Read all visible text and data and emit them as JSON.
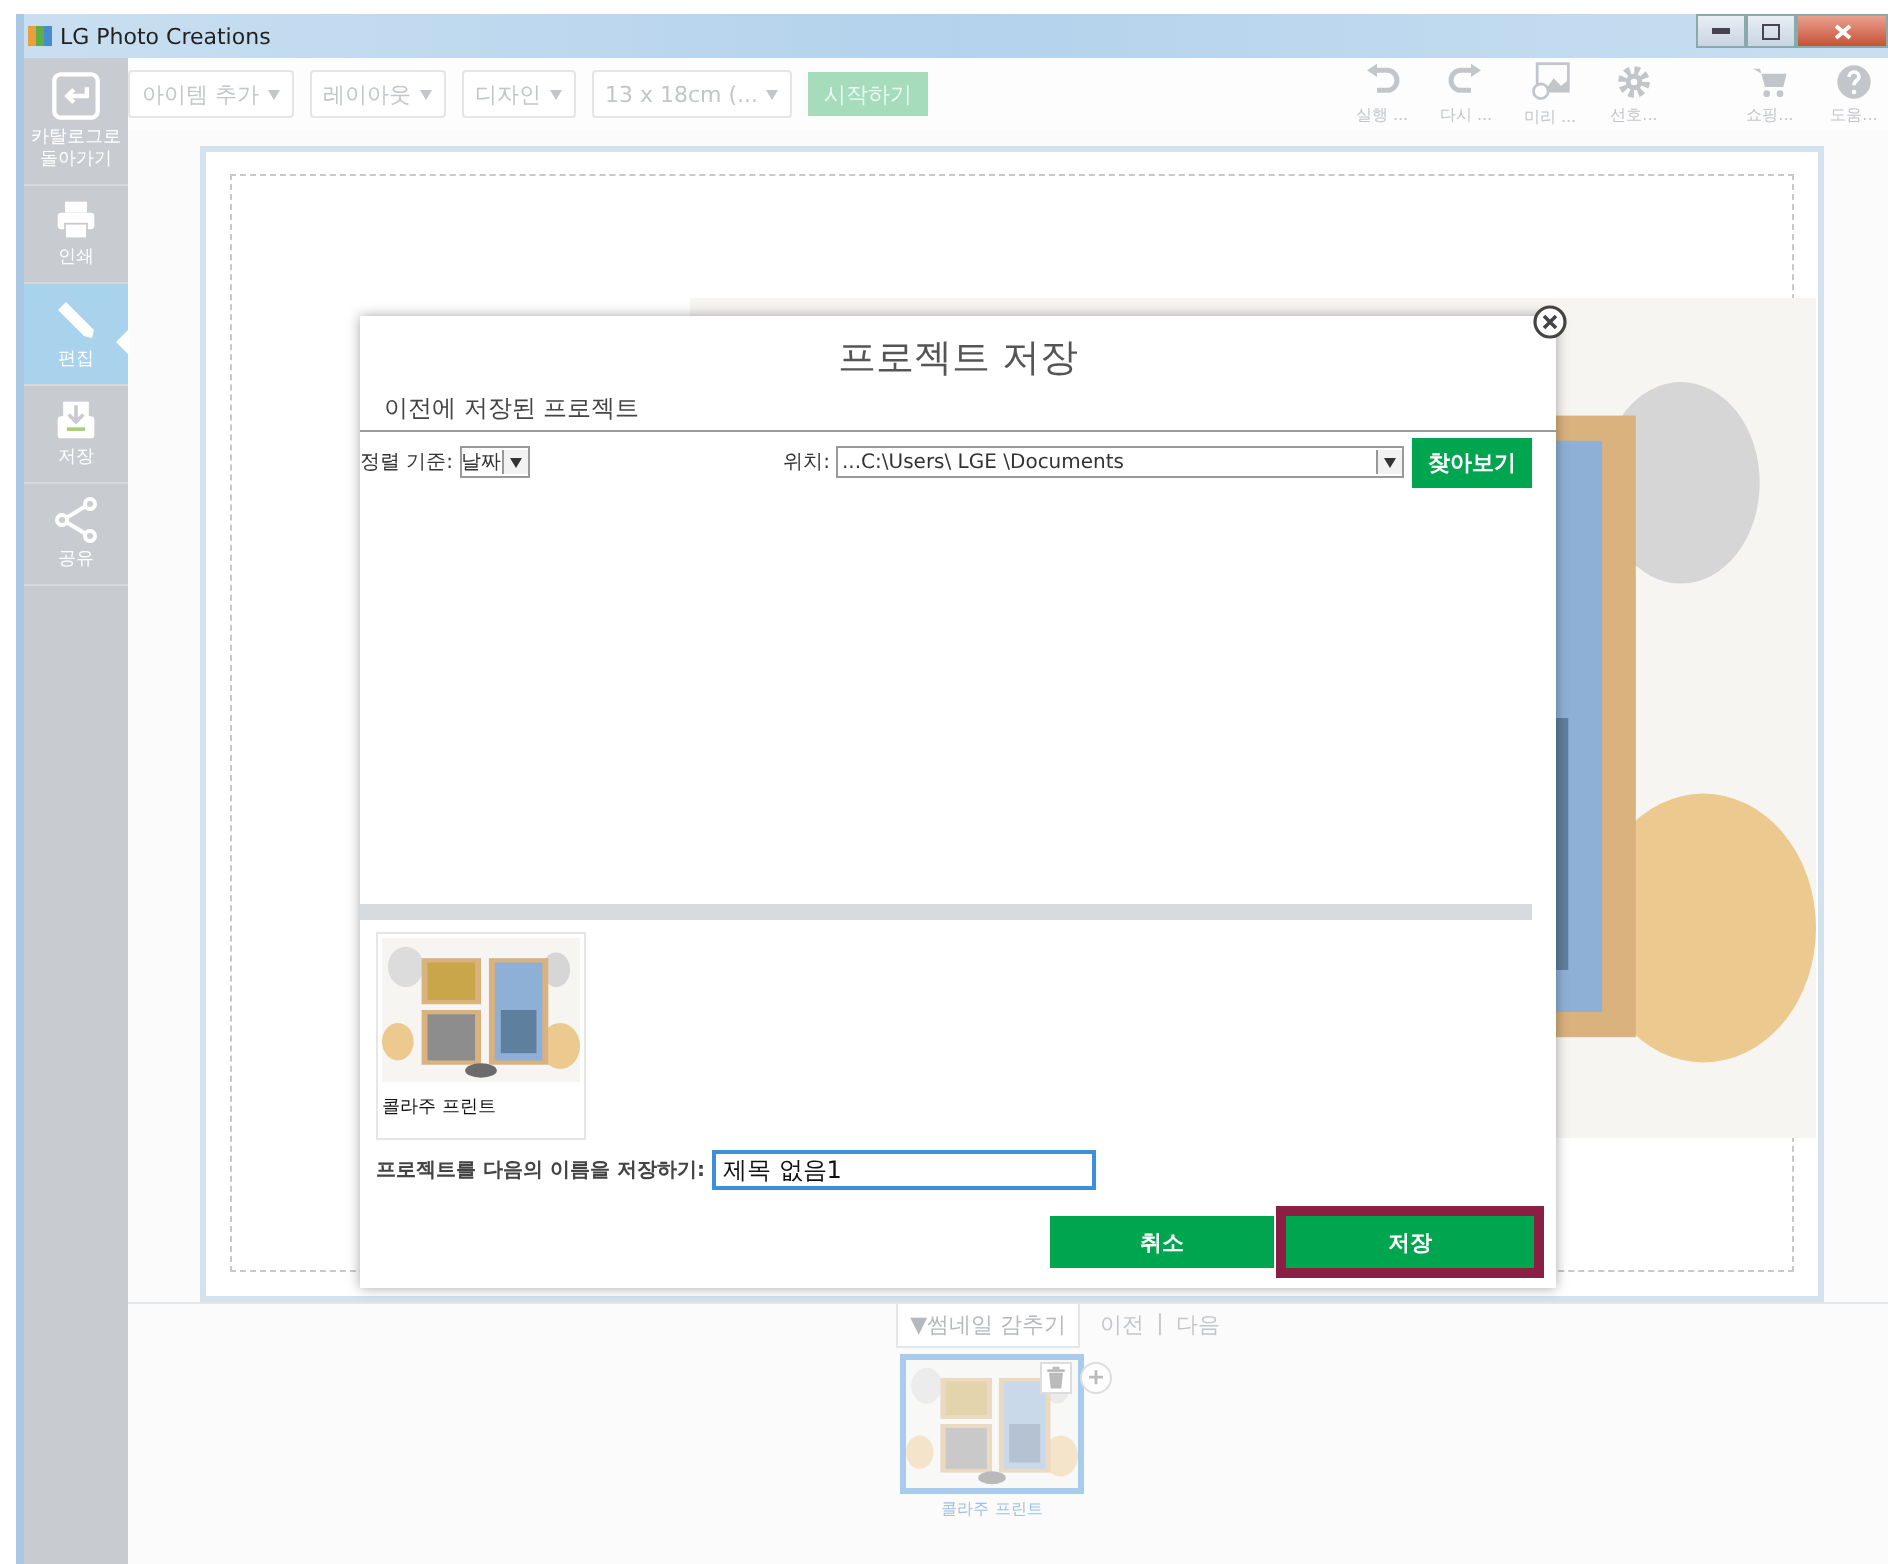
{
  "window": {
    "title": "LG Photo Creations"
  },
  "sidebar": {
    "items": [
      {
        "label": "카탈로그로 돌아가기",
        "selected": false
      },
      {
        "label": "인쇄",
        "selected": false
      },
      {
        "label": "편집",
        "selected": true
      },
      {
        "label": "저장",
        "selected": false
      },
      {
        "label": "공유",
        "selected": false
      }
    ]
  },
  "toolbar": {
    "disabled": true,
    "menus": [
      "아이템 추가",
      "레이아웃",
      "디자인",
      "13 x 18cm (..."
    ],
    "start_button": "시작하기",
    "actions": [
      "실행 ...",
      "다시 ...",
      "미리 ...",
      "선호...",
      "쇼핑...",
      "도움..."
    ]
  },
  "dialog": {
    "title": "프로젝트 저장",
    "section": "이전에 저장된 프로젝트",
    "sort_label": "정렬 기준:",
    "sort_value": "날짜",
    "location_label": "위치:",
    "location_value": "...C:\\Users\\ LGE \\Documents",
    "browse_button": "찾아보기",
    "projects": [
      {
        "name": "콜라주 프린트"
      }
    ],
    "name_label": "프로젝트를 다음의 이름을 저장하기:",
    "name_value": "제목 없음1",
    "buttons": [
      {
        "label": "취소",
        "highlighted": false
      },
      {
        "label": "저장",
        "highlighted": true
      }
    ]
  },
  "thumbnail_bar": {
    "toggle": "▼썸네일 감추기",
    "prev": "이전",
    "separator": "|",
    "next": "다음",
    "thumbnails": [
      {
        "caption": "콜라주 프린트",
        "selected": true
      }
    ]
  }
}
